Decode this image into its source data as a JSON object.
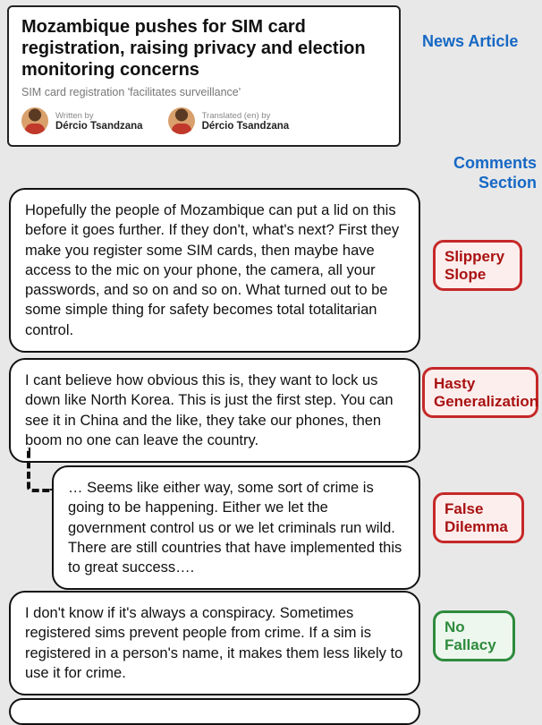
{
  "article": {
    "title": "Mozambique pushes for SIM card registration, raising privacy and election monitoring concerns",
    "subtitle": "SIM card registration 'facilitates surveillance'",
    "written_role": "Written by",
    "written_name": "Dércio Tsandzana",
    "translated_role": "Translated (en) by",
    "translated_name": "Dércio Tsandzana"
  },
  "labels": {
    "news": "News Article",
    "comments": "Comments Section"
  },
  "comments": {
    "c1": "Hopefully the people of Mozambique can put a lid on this before it goes further. If they don't, what's next? First they make you register some SIM cards, then maybe have access to the mic on your phone, the camera, all your passwords, and so on and so on. What turned out to be some simple thing for safety becomes total totalitarian control.",
    "c2": "I cant believe how obvious this is, they want to lock us down like North Korea. This is just the first step. You can see it in China and the like, they take our phones, then boom no one can leave the country.",
    "c3": "… Seems like either way, some sort of crime is going to be happening. Either we let the government control us or we let criminals run wild. There are still countries that have implemented this to great success….",
    "c4": "I don't know if it's always a conspiracy. Sometimes registered sims prevent people from crime. If a sim is registered in a person's name, it makes them less likely to use it for crime."
  },
  "tags": {
    "t1": "Slippery Slope",
    "t2": "Hasty Generalization",
    "t3": "False Dilemma",
    "t4": "No Fallacy"
  }
}
